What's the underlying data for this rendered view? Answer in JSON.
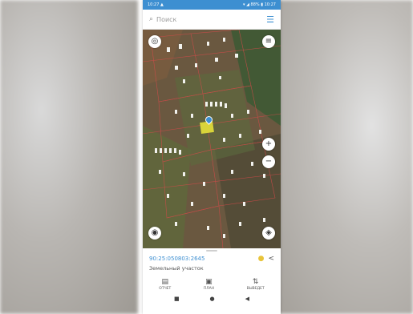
{
  "status_bar": {
    "left": "10:27 ▲",
    "right": "▾ ◢ 88% ▮ 10:27"
  },
  "search": {
    "placeholder": "Поиск",
    "search_icon": "search-icon",
    "menu_icon": "menu-icon"
  },
  "map": {
    "buttons": [
      "layers-icon",
      "compass-icon",
      "zoom-in-icon",
      "zoom-out-icon",
      "locate-icon",
      "gps-icon"
    ],
    "selected_parcel_color": "#e6e03a",
    "marker_color": "#3d8fd1"
  },
  "parcel": {
    "cadastral_number": "90:25:050803:2645",
    "type": "Земельный участок"
  },
  "bottom_nav": [
    {
      "label": "ОТЧЕТ",
      "icon": "report-icon"
    },
    {
      "label": "ПЛАН",
      "icon": "plan-icon"
    },
    {
      "label": "ВЫВЕДЕТ",
      "icon": "export-icon"
    }
  ],
  "system_nav": [
    "■",
    "●",
    "◀"
  ],
  "colors": {
    "accent": "#3d8fd1",
    "map_bg": "#6b5a3f"
  }
}
